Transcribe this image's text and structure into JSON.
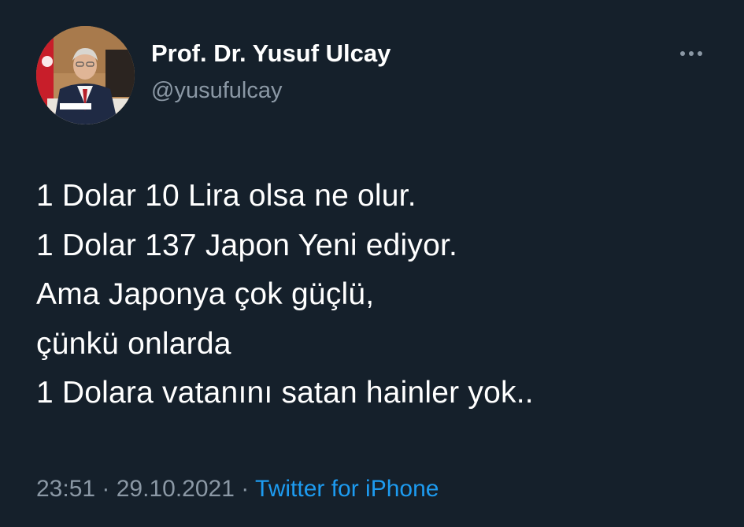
{
  "author": {
    "name": "Prof. Dr. Yusuf Ulcay",
    "handle": "@yusufulcay"
  },
  "more_icon": "more-horizontal-icon",
  "tweet": {
    "lines": [
      "1 Dolar 10 Lira olsa ne olur.",
      "1 Dolar 137 Japon Yeni ediyor.",
      "Ama Japonya çok güçlü,",
      "çünkü onlarda",
      "1 Dolara vatanını satan hainler yok.."
    ]
  },
  "meta": {
    "time": "23:51",
    "separator": " · ",
    "date": "29.10.2021",
    "source": "Twitter for iPhone"
  },
  "colors": {
    "background": "#15202b",
    "text": "#ffffff",
    "secondary_text": "#8b98a5",
    "link": "#1d9bf0"
  }
}
